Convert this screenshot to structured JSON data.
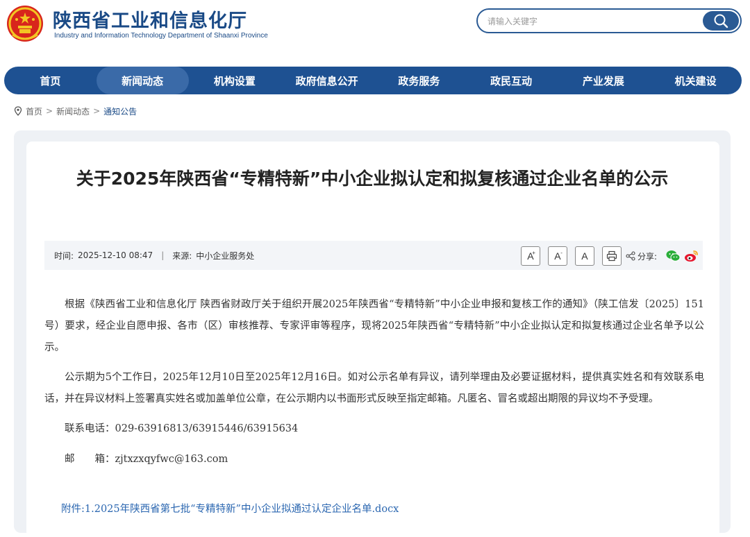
{
  "site": {
    "title": "陕西省工业和信息化厅",
    "subtitle": "Industry and Information Technology Department of Shaanxi Province"
  },
  "search": {
    "placeholder": "请输入关键字",
    "icon": "search-icon"
  },
  "nav": {
    "items": [
      {
        "label": "首页",
        "active": false
      },
      {
        "label": "新闻动态",
        "active": true
      },
      {
        "label": "机构设置",
        "active": false
      },
      {
        "label": "政府信息公开",
        "active": false
      },
      {
        "label": "政务服务",
        "active": false
      },
      {
        "label": "政民互动",
        "active": false
      },
      {
        "label": "产业发展",
        "active": false
      },
      {
        "label": "机关建设",
        "active": false
      }
    ]
  },
  "breadcrumb": {
    "items": [
      "首页",
      "新闻动态",
      "通知公告"
    ],
    "separator": ">"
  },
  "article": {
    "title": "关于2025年陕西省“专精特新”中小企业拟认定和拟复核通过企业名单的公示",
    "time_label": "时间:",
    "time": "2025-12-10 08:47",
    "divider": "|",
    "source_label": "来源:",
    "source": "中小企业服务处",
    "font_large": "A",
    "font_medium": "A",
    "font_small": "A",
    "font_large_sup": "+",
    "font_medium_sup": "-",
    "share_label": "分享:",
    "paragraphs": [
      "根据《陕西省工业和信息化厅 陕西省财政厅关于组织开展2025年陕西省“专精特新”中小企业申报和复核工作的通知》（陕工信发〔2025〕151号）要求，经企业自愿申报、各市（区）审核推荐、专家评审等程序，现将2025年陕西省“专精特新”中小企业拟认定和拟复核通过企业名单予以公示。",
      "公示期为5个工作日，2025年12月10日至2025年12月16日。如对公示名单有异议，请列举理由及必要证据材料，提供真实姓名和有效联系电话，并在异议材料上签署真实姓名或加盖单位公章，在公示期内以书面形式反映至指定邮箱。凡匿名、冒名或超出期限的异议均不予受理。"
    ],
    "phone_line": "联系电话：029-63916813/63915446/63915634",
    "email_line": "邮　　箱：zjtxzxqyfwc@163.com",
    "attachment": "附件:1.2025年陕西省第七批“专精特新”中小企业拟通过认定企业名单.docx"
  },
  "colors": {
    "brand": "#1e5192",
    "nav_active": "#3a6aa8",
    "link": "#2a66b0"
  }
}
